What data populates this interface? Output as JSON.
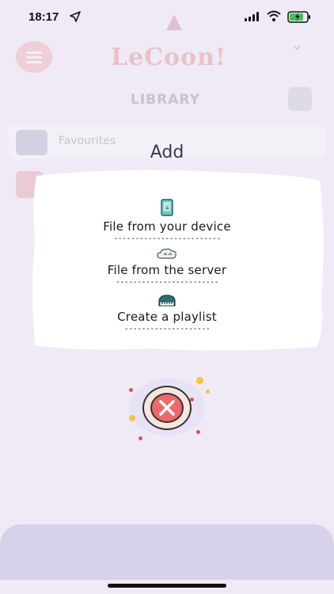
{
  "status_bar": {
    "time": "18:17"
  },
  "background_app": {
    "logo_text": "LeCoon!",
    "section_title": "LIBRARY",
    "row_label": "Favourites"
  },
  "dialog": {
    "title": "Add",
    "options": [
      {
        "label": "File from your device",
        "icon": "phone-icon",
        "underline": "-------------------------"
      },
      {
        "label": "File from the server",
        "icon": "cloud-icon",
        "underline": "------------------------"
      },
      {
        "label": "Create a playlist",
        "icon": "piano-icon",
        "underline": "--------------------"
      }
    ],
    "close_icon": "close-icon"
  },
  "colors": {
    "accent_red": "#ec6a6b",
    "halo": "#e6e3f7",
    "card": "#ffffff"
  }
}
